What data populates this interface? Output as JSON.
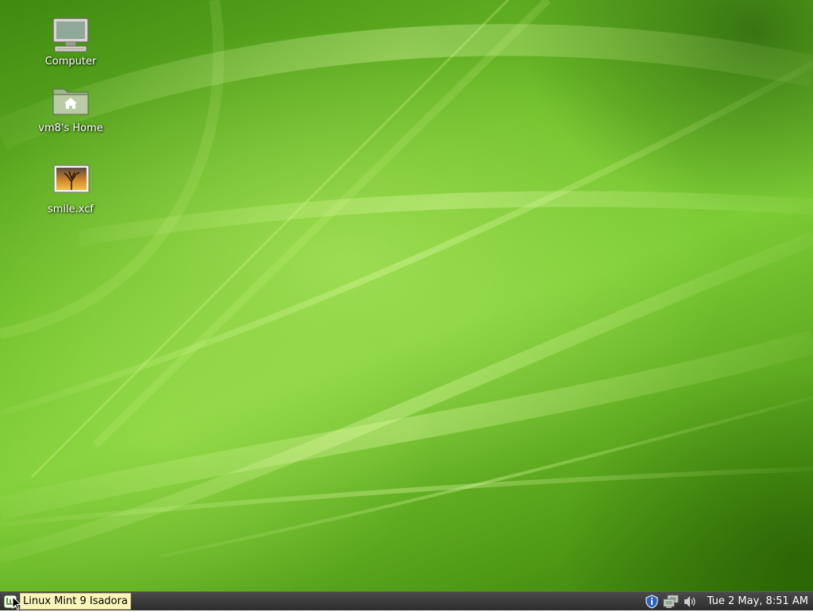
{
  "desktop": {
    "icons": [
      {
        "label": "Computer",
        "icon": "computer-icon"
      },
      {
        "label": "vm8's Home",
        "icon": "home-folder-icon"
      },
      {
        "label": "smile.xcf",
        "icon": "image-file-icon"
      }
    ]
  },
  "panel": {
    "menu_label": "Linux Mint 9 Isadora",
    "menu_icon": "mint-menu-icon",
    "tray": [
      {
        "icon": "shield-update-icon"
      },
      {
        "icon": "network-icon"
      },
      {
        "icon": "volume-icon"
      }
    ],
    "clock": "Tue  2 May,  8:51 AM"
  },
  "colors": {
    "wallpaper": "#6fbf2a",
    "panel": "#3a3a3a",
    "menu_label_bg": "#fbf6b8"
  }
}
